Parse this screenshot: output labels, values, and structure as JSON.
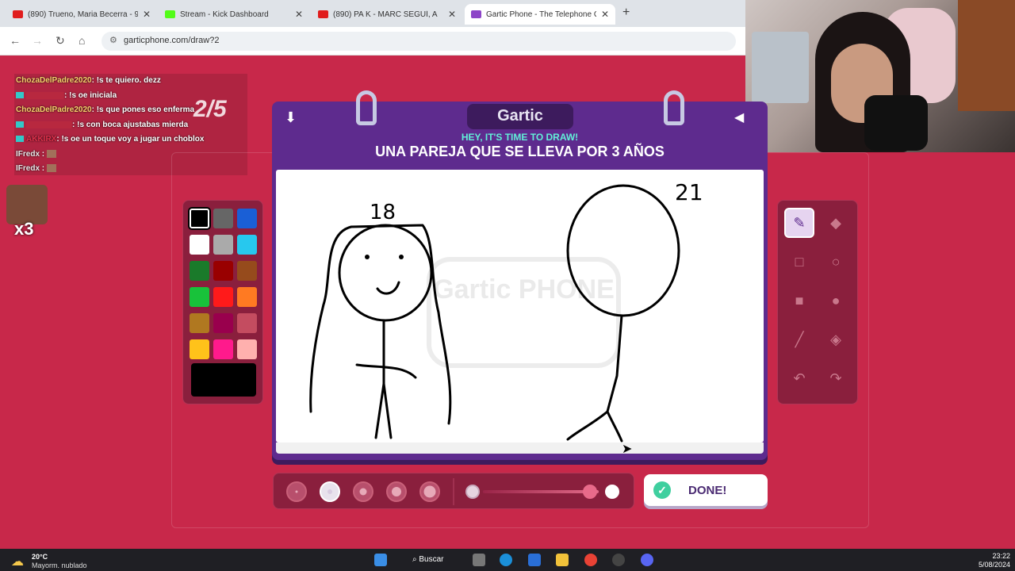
{
  "browser": {
    "tabs": [
      {
        "title": "(890) Trueno, Maria Becerra - 9",
        "favicon_color": "#e01d1d"
      },
      {
        "title": "Stream - Kick Dashboard",
        "favicon_color": "#53fc18"
      },
      {
        "title": "(890) PA K - MARC SEGUÍ, A",
        "favicon_color": "#e01d1d"
      },
      {
        "title": "Gartic Phone - The Telephone G",
        "favicon_color": "#8d45c8"
      }
    ],
    "new_tab": "+",
    "close": "✕",
    "url": "garticphone.com/draw?2"
  },
  "chat": {
    "lines": [
      {
        "user": "ChozaDelPadre2020",
        "text": ": !s te quiero. dezz",
        "user_style": "yellow",
        "badge": false
      },
      {
        "user": "",
        "text": ": !s oe iniciala",
        "user_style": "red",
        "badge": true
      },
      {
        "user": "ChozaDelPadre2020",
        "text": ": !s que pones eso enferma",
        "user_style": "yellow",
        "badge": false
      },
      {
        "user": "",
        "text": ": !s con boca ajustabas mierda",
        "user_style": "red",
        "badge": true
      },
      {
        "user": "AKKIRX",
        "text": ": !s oe un toque voy a jugar un choblox",
        "user_style": "red",
        "badge": true
      },
      {
        "user": "IFredx",
        "text": " :",
        "user_style": "gray",
        "badge": false,
        "emote": true
      },
      {
        "user": "IFredx",
        "text": " :",
        "user_style": "gray",
        "badge": false,
        "emote": true
      }
    ],
    "counter": "2/5",
    "emote_multiplier": "x3"
  },
  "game": {
    "logo": "Gartic",
    "hey": "HEY, IT'S TIME TO DRAW!",
    "prompt": "UNA PAREJA QUE SE LLEVA POR 3 AÑOS",
    "watermark": "Gartic PHONE",
    "done_label": "DONE!",
    "annotations": {
      "left_age": "18",
      "right_age": "21"
    }
  },
  "palette": {
    "colors": [
      "#000000",
      "#666666",
      "#1a5fd6",
      "#ffffff",
      "#aaaaaa",
      "#27c8ee",
      "#1a7a2a",
      "#990000",
      "#964b1c",
      "#18c23a",
      "#ff1a1a",
      "#ff7a22",
      "#b07820",
      "#99004d",
      "#c44c60",
      "#ffc21a",
      "#ff1a8c",
      "#ffb0ae"
    ],
    "selected_index": 0,
    "current_color": "#000000"
  },
  "tools": [
    {
      "name": "pencil",
      "glyph": "✎",
      "selected": true
    },
    {
      "name": "eraser",
      "glyph": "◆",
      "selected": false
    },
    {
      "name": "rectangle",
      "glyph": "□",
      "selected": false
    },
    {
      "name": "ellipse",
      "glyph": "○",
      "selected": false
    },
    {
      "name": "filled-rectangle",
      "glyph": "■",
      "selected": false
    },
    {
      "name": "filled-ellipse",
      "glyph": "●",
      "selected": false
    },
    {
      "name": "line",
      "glyph": "╱",
      "selected": false
    },
    {
      "name": "bucket",
      "glyph": "◈",
      "selected": false
    },
    {
      "name": "undo",
      "glyph": "↶",
      "selected": false
    },
    {
      "name": "redo",
      "glyph": "↷",
      "selected": false
    }
  ],
  "brush_sizes": {
    "count": 5,
    "selected_index": 1
  },
  "taskbar": {
    "weather_temp": "20°C",
    "weather_desc": "Mayorm. nublado",
    "search_label": "Buscar",
    "time": "23:22",
    "date": "5/08/2024"
  }
}
